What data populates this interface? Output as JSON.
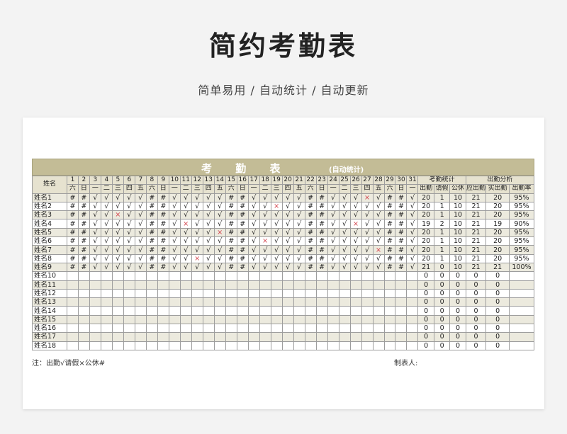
{
  "header": {
    "title": "简约考勤表",
    "subtitle": "简单易用 / 自动统计 / 自动更新"
  },
  "sheet": {
    "title": "考 勤 表",
    "title_note": "(自动统计)",
    "name_header": "姓名",
    "days": [
      "1",
      "2",
      "3",
      "4",
      "5",
      "6",
      "7",
      "8",
      "9",
      "10",
      "11",
      "12",
      "13",
      "14",
      "15",
      "16",
      "17",
      "18",
      "19",
      "20",
      "21",
      "22",
      "23",
      "24",
      "25",
      "26",
      "27",
      "28",
      "29",
      "30",
      "31"
    ],
    "weekdays": [
      "六",
      "日",
      "一",
      "二",
      "三",
      "四",
      "五",
      "六",
      "日",
      "一",
      "二",
      "三",
      "四",
      "五",
      "六",
      "日",
      "一",
      "二",
      "三",
      "四",
      "五",
      "六",
      "日",
      "一",
      "二",
      "三",
      "四",
      "五",
      "六",
      "日",
      "一"
    ],
    "stats_group": "考勤统计",
    "analysis_group": "出勤分析",
    "stats_headers": [
      "出勤",
      "请假",
      "公休"
    ],
    "analysis_headers": [
      "应出勤",
      "实出勤",
      "出勤率"
    ],
    "rows": [
      {
        "name": "姓名1",
        "marks": "##√√√√√##√√√√√##√√√√√##√√√×√##√",
        "stats": [
          "20",
          "1",
          "10"
        ],
        "analysis": [
          "21",
          "20",
          "95%"
        ]
      },
      {
        "name": "姓名2",
        "marks": "##√√√√√##√√√√√##√√×√√##√√√√√##√",
        "stats": [
          "20",
          "1",
          "10"
        ],
        "analysis": [
          "21",
          "20",
          "95%"
        ]
      },
      {
        "name": "姓名3",
        "marks": "##√√×√√##√√√√√##√√√√√##√√√√√##√",
        "stats": [
          "20",
          "1",
          "10"
        ],
        "analysis": [
          "21",
          "20",
          "95%"
        ]
      },
      {
        "name": "姓名4",
        "marks": "##√√√√√##√×√√√##√√√√√##√√×√√##√",
        "stats": [
          "19",
          "2",
          "10"
        ],
        "analysis": [
          "21",
          "19",
          "90%"
        ]
      },
      {
        "name": "姓名5",
        "marks": "##√√√√√##√√√√×##√√√√√##√√√√√##√",
        "stats": [
          "20",
          "1",
          "10"
        ],
        "analysis": [
          "21",
          "20",
          "95%"
        ]
      },
      {
        "name": "姓名6",
        "marks": "##√√√√√##√√√√√##√×√√√##√√√√√##√",
        "stats": [
          "20",
          "1",
          "10"
        ],
        "analysis": [
          "21",
          "20",
          "95%"
        ]
      },
      {
        "name": "姓名7",
        "marks": "##√√√√√##√√√√√##√√√√√##√√√√×##√",
        "stats": [
          "20",
          "1",
          "10"
        ],
        "analysis": [
          "21",
          "20",
          "95%"
        ]
      },
      {
        "name": "姓名8",
        "marks": "##√√√√√##√√×√√##√√√√√##√√√√√##√",
        "stats": [
          "20",
          "1",
          "10"
        ],
        "analysis": [
          "21",
          "20",
          "95%"
        ]
      },
      {
        "name": "姓名9",
        "marks": "##√√√√√##√√√√√##√√√√√##√√√√√##√",
        "stats": [
          "21",
          "0",
          "10"
        ],
        "analysis": [
          "21",
          "21",
          "100%"
        ]
      },
      {
        "name": "姓名10",
        "marks": "",
        "stats": [
          "0",
          "0",
          "0"
        ],
        "analysis": [
          "0",
          "0",
          ""
        ]
      },
      {
        "name": "姓名11",
        "marks": "",
        "stats": [
          "0",
          "0",
          "0"
        ],
        "analysis": [
          "0",
          "0",
          ""
        ]
      },
      {
        "name": "姓名12",
        "marks": "",
        "stats": [
          "0",
          "0",
          "0"
        ],
        "analysis": [
          "0",
          "0",
          ""
        ]
      },
      {
        "name": "姓名13",
        "marks": "",
        "stats": [
          "0",
          "0",
          "0"
        ],
        "analysis": [
          "0",
          "0",
          ""
        ]
      },
      {
        "name": "姓名14",
        "marks": "",
        "stats": [
          "0",
          "0",
          "0"
        ],
        "analysis": [
          "0",
          "0",
          ""
        ]
      },
      {
        "name": "姓名15",
        "marks": "",
        "stats": [
          "0",
          "0",
          "0"
        ],
        "analysis": [
          "0",
          "0",
          ""
        ]
      },
      {
        "name": "姓名16",
        "marks": "",
        "stats": [
          "0",
          "0",
          "0"
        ],
        "analysis": [
          "0",
          "0",
          ""
        ]
      },
      {
        "name": "姓名17",
        "marks": "",
        "stats": [
          "0",
          "0",
          "0"
        ],
        "analysis": [
          "0",
          "0",
          ""
        ]
      },
      {
        "name": "姓名18",
        "marks": "",
        "stats": [
          "0",
          "0",
          "0"
        ],
        "analysis": [
          "0",
          "0",
          ""
        ]
      }
    ],
    "note_label": "注：出勤√请假×公休#",
    "maker_label": "制表人:"
  },
  "colors": {
    "band": "#c3bc96",
    "row_alt": "#eceade",
    "absent": "#d4404a"
  }
}
